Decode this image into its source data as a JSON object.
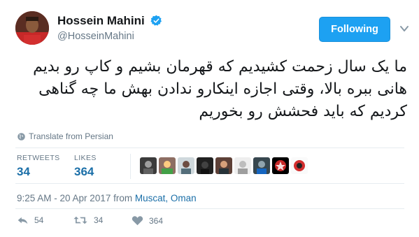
{
  "user": {
    "display_name": "Hossein Mahini",
    "handle": "@HosseinMahini",
    "verified": true
  },
  "follow_button_label": "Following",
  "tweet": {
    "lines": [
      "ما یک سال زحمت کشیدیم که قهرمان بشیم و کاپ رو بدیم",
      "هانی ببره بالا، وقتی اجازه اینکارو ندادن بهش ما چه گناهی",
      "کردیم که باید فحشش رو بخوریم"
    ]
  },
  "translate_label": "Translate from Persian",
  "stats": {
    "retweets_label": "RETWEETS",
    "retweets_value": "34",
    "likes_label": "LIKES",
    "likes_value": "364"
  },
  "liker_avatars": [
    "avatar-1",
    "avatar-2",
    "avatar-3",
    "avatar-4",
    "avatar-5",
    "avatar-6",
    "avatar-7",
    "avatar-8",
    "avatar-9"
  ],
  "meta": {
    "time_date": "9:25 AM - 20 Apr 2017 from ",
    "location": "Muscat, Oman"
  },
  "actions": {
    "reply_count": "54",
    "retweet_count": "34",
    "like_count": "364"
  },
  "colors": {
    "accent": "#1da1f2",
    "link": "#1b6fa8",
    "muted": "#657786"
  }
}
